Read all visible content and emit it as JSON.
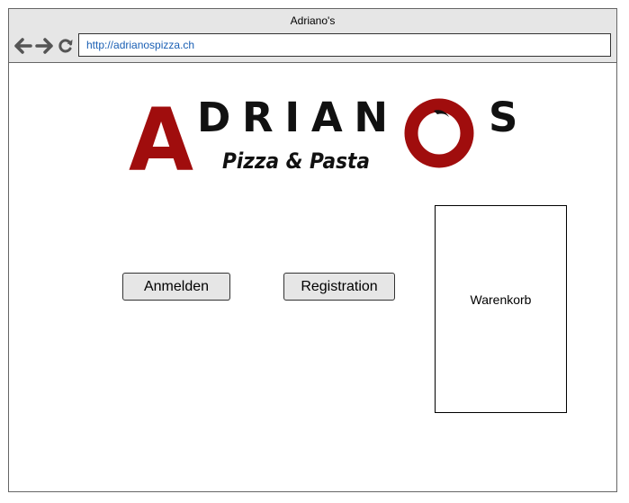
{
  "browser": {
    "title": "Adriano's",
    "url": "http://adrianospizza.ch",
    "nav_icons": [
      "arrow-left-icon",
      "arrow-right-icon",
      "reload-icon"
    ]
  },
  "logo": {
    "initial": "A",
    "name": "DRIAN",
    "ending": "S",
    "tagline": "Pizza & Pasta",
    "brand_color": "#a00d0d"
  },
  "buttons": {
    "login_label": "Anmelden",
    "register_label": "Registration"
  },
  "cart": {
    "label": "Warenkorb"
  }
}
